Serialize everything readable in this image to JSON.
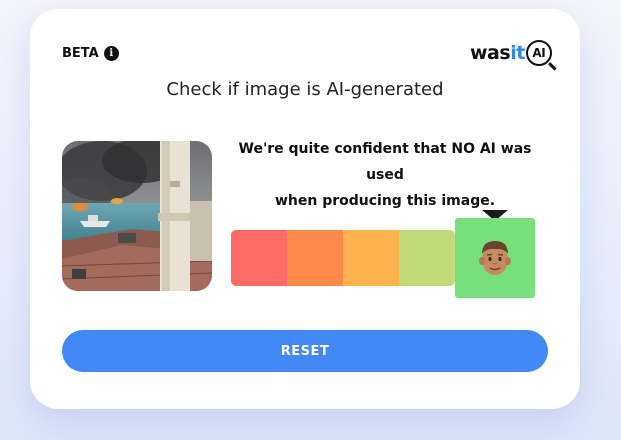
{
  "header": {
    "beta_label": "BETA",
    "info_icon": "info-icon",
    "logo_text_1": "was",
    "logo_text_2": "it",
    "logo_ai": "AI"
  },
  "title": "Check if image is AI-generated",
  "result": {
    "line1": "We're quite confident that NO AI was used",
    "line2": "when producing this image.",
    "meter_level": 5,
    "meter_max": 5,
    "meter_colors": [
      "#fe6b66",
      "#fe8b4a",
      "#feb24d",
      "#bfdc78",
      "#78e07a"
    ],
    "marker_icon": "man-emoji-icon",
    "pointer_color": "#1a1a1a"
  },
  "actions": {
    "reset_label": "RESET"
  },
  "colors": {
    "accent": "#4289f6",
    "logo_accent": "#2e86f5"
  }
}
